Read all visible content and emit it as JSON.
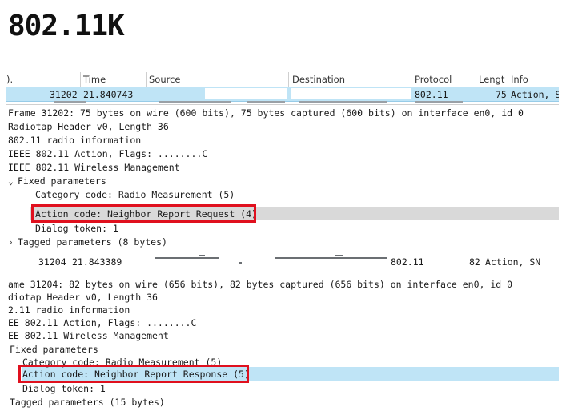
{
  "title": "802.11K",
  "shot1": {
    "columns": {
      "no": ").",
      "time": "Time",
      "source": "Source",
      "destination": "Destination",
      "protocol": "Protocol",
      "length": "Lengt",
      "info": "Info"
    },
    "packet": {
      "no": "31202",
      "time": "21.840743",
      "protocol": "802.11",
      "length": "75",
      "info": "Action, S"
    },
    "details": [
      "Frame 31202: 75 bytes on wire (600 bits), 75 bytes captured (600 bits) on interface en0, id 0",
      "Radiotap Header v0, Length 36",
      "802.11 radio information",
      "IEEE 802.11 Action, Flags: ........C",
      "IEEE 802.11 Wireless Management",
      "Fixed parameters",
      "Category code: Radio Measurement (5)",
      "Action code: Neighbor Report Request (4)",
      "Dialog token: 1",
      "Tagged parameters (8 bytes)"
    ],
    "chevron_open": "⌄",
    "chevron_closed": "›"
  },
  "shot2": {
    "packet": {
      "no": "31204",
      "time": "21.843389",
      "protocol": "802.11",
      "length": "82",
      "info": "Action, SN"
    },
    "details": [
      "ame 31204: 82 bytes on wire (656 bits), 82 bytes captured (656 bits) on interface en0, id 0",
      "diotap Header v0, Length 36",
      "2.11 radio information",
      "EE 802.11 Action, Flags: ........C",
      "EE 802.11 Wireless Management",
      "Fixed parameters",
      "Category code: Radio Measurement (5)",
      "Action code: Neighbor Report Response (5)",
      "Dialog token: 1",
      "Tagged parameters (15 bytes)"
    ]
  },
  "colors": {
    "highlight_red": "#e0101e",
    "selection_blue": "#bfe4f6",
    "selection_grey": "#d9d9d9"
  }
}
